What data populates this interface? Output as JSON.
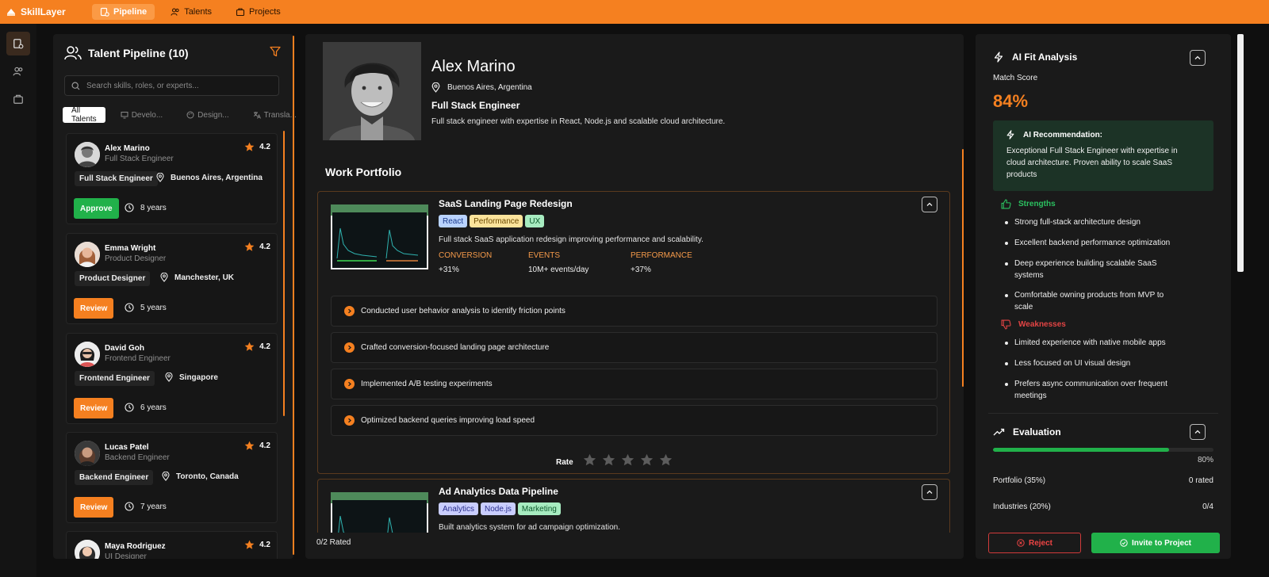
{
  "app": {
    "name": "SkillLayer"
  },
  "nav": {
    "items": [
      {
        "label": "Pipeline"
      },
      {
        "label": "Talents"
      },
      {
        "label": "Projects"
      }
    ]
  },
  "pipeline": {
    "title": "Talent Pipeline (10)",
    "search_placeholder": "Search skills, roles, or experts...",
    "tabs": [
      {
        "label": "All Talents"
      },
      {
        "label": "Develo..."
      },
      {
        "label": "Design..."
      },
      {
        "label": "Transla..."
      }
    ],
    "cards": [
      {
        "name": "Alex Marino",
        "role": "Full Stack Engineer",
        "rating": "4.2",
        "tag": "Full Stack Engineer",
        "location": "Buenos Aires, Argentina",
        "action": "Approve",
        "experience": "8 years"
      },
      {
        "name": "Emma Wright",
        "role": "Product Designer",
        "rating": "4.2",
        "tag": "Product Designer",
        "location": "Manchester, UK",
        "action": "Review",
        "experience": "5 years"
      },
      {
        "name": "David Goh",
        "role": "Frontend Engineer",
        "rating": "4.2",
        "tag": "Frontend Engineer",
        "location": "Singapore",
        "action": "Review",
        "experience": "6 years"
      },
      {
        "name": "Lucas Patel",
        "role": "Backend Engineer",
        "rating": "4.2",
        "tag": "Backend Engineer",
        "location": "Toronto, Canada",
        "action": "Review",
        "experience": "7 years"
      },
      {
        "name": "Maya Rodriguez",
        "role": "UI Designer",
        "rating": "4.2"
      }
    ]
  },
  "profile": {
    "name": "Alex Marino",
    "location": "Buenos Aires, Argentina",
    "role": "Full Stack Engineer",
    "description": "Full stack engineer with expertise in React, Node.js and scalable cloud architecture.",
    "portfolio_title": "Work Portfolio",
    "rated_count": "0/2 Rated",
    "projects": [
      {
        "title": "SaaS Landing Page Redesign",
        "tags": [
          "React",
          "Performance",
          "UX"
        ],
        "description": "Full stack SaaS application redesign improving performance and scalability.",
        "metrics": [
          {
            "label": "CONVERSION",
            "value": "+31%"
          },
          {
            "label": "EVENTS",
            "value": "10M+ events/day"
          },
          {
            "label": "PERFORMANCE",
            "value": "+37%"
          }
        ],
        "tasks": [
          "Conducted user behavior analysis to identify friction points",
          "Crafted conversion-focused landing page architecture",
          "Implemented A/B testing experiments",
          "Optimized backend queries improving load speed"
        ],
        "rate_label": "Rate",
        "rating": 0,
        "rating_max": 5
      },
      {
        "title": "Ad Analytics Data Pipeline",
        "tags": [
          "Analytics",
          "Node.js",
          "Marketing"
        ],
        "description": "Built analytics system for ad campaign optimization."
      }
    ]
  },
  "ai": {
    "title": "AI Fit Analysis",
    "match_label": "Match Score",
    "match_score": "84%",
    "recommendation_title": "AI Recommendation:",
    "recommendation": "Exceptional Full Stack Engineer with expertise in cloud architecture. Proven ability to scale SaaS products",
    "strengths_title": "Strengths",
    "strengths": [
      "Strong full-stack architecture design",
      "Excellent backend performance optimization",
      "Deep experience building scalable SaaS systems",
      "Comfortable owning products from MVP to scale"
    ],
    "weaknesses_title": "Weaknesses",
    "weaknesses": [
      "Limited experience with native mobile apps",
      "Less focused on UI visual design",
      "Prefers async communication over frequent meetings"
    ],
    "evaluation_title": "Evaluation",
    "evaluation_progress": 0.8,
    "evaluation_pct": "80%",
    "evaluation_rows": [
      {
        "label": "Portfolio (35%)",
        "value": "0 rated"
      },
      {
        "label": "Industries (20%)",
        "value": "0/4"
      }
    ],
    "reject_label": "Reject",
    "invite_label": "Invite to Project"
  },
  "colors": {
    "accent": "#f58020",
    "success": "#21b14a",
    "danger": "#e34444"
  }
}
